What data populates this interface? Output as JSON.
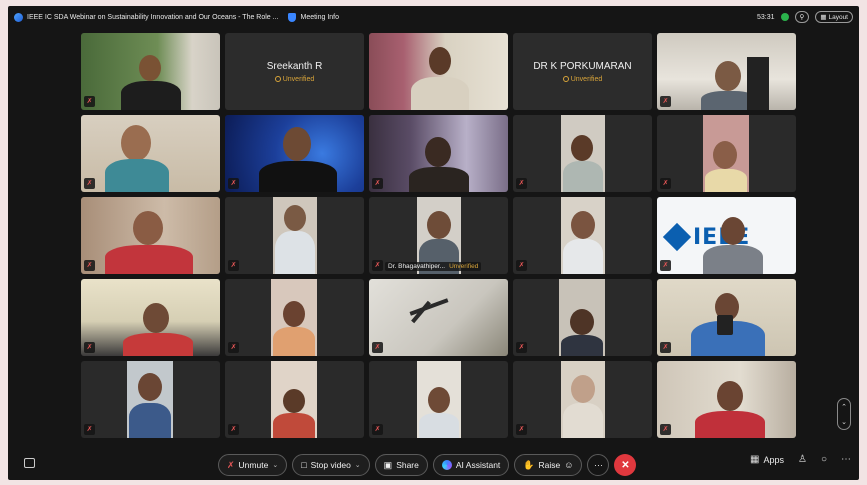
{
  "titlebar": {
    "title": "IEEE IC SDA Webinar on Sustainability Innovation and Our Oceans - The Role ...",
    "meeting_info": "Meeting Info",
    "timer": "53:31",
    "layout_label": "Layout"
  },
  "tiles": [
    {
      "id": "p1",
      "type": "video"
    },
    {
      "id": "p2",
      "type": "name",
      "name": "Sreekanth R",
      "status": "Unverified"
    },
    {
      "id": "p3",
      "type": "video"
    },
    {
      "id": "p4",
      "type": "name",
      "name": "DR K PORKUMARAN",
      "status": "Unverified"
    },
    {
      "id": "p5",
      "type": "video"
    },
    {
      "id": "p11",
      "type": "video",
      "name": "Dr. Bhagavathiper...",
      "status": "Unverified"
    },
    {
      "id": "p15",
      "type": "video",
      "logo": "IEEE"
    }
  ],
  "toolbar": {
    "unmute": "Unmute",
    "stop_video": "Stop video",
    "share": "Share",
    "ai_assistant": "AI Assistant",
    "raise": "Raise",
    "apps": "Apps"
  },
  "icons": {
    "mute": "mic-muted-icon",
    "leave": "leave-icon",
    "chat": "chat-icon"
  },
  "colors": {
    "background": "#151515",
    "leave": "#e0383e",
    "unverified": "#d9a53a",
    "mute": "#e25555"
  }
}
